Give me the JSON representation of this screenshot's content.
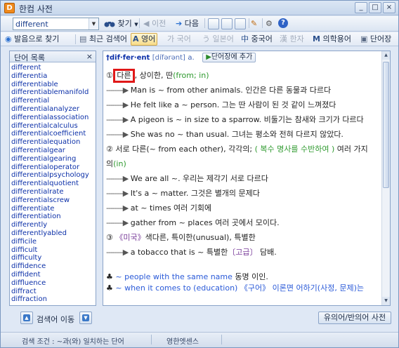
{
  "window": {
    "app_icon": "D",
    "title": "한컴 사전",
    "controls": [
      "_",
      "□",
      "×"
    ]
  },
  "toolbar": {
    "search_value": "different",
    "find_label": "찾기",
    "prev_label": "이전",
    "next_label": "다음"
  },
  "filters": {
    "pronounce_find": "발음으로 찾기",
    "recent": "최근 검색어",
    "english": "영어",
    "korean": "국어",
    "japanese": "일본어",
    "chinese": "중국어",
    "hanja": "한자",
    "medical": "의학용어",
    "wordbook": "단어장"
  },
  "left_panel": {
    "title": "단어 목록",
    "close": "×",
    "words": [
      "different",
      "differentia",
      "differentiable",
      "differentiablemanifold",
      "differential",
      "differentialanalyzer",
      "differentialassociation",
      "differentialcalculus",
      "differentialcoefficient",
      "differentialequation",
      "differentialgear",
      "differentialgearing",
      "differentialoperator",
      "differentialpsychology",
      "differentialquotient",
      "differentialrate",
      "differentialscrew",
      "differentiate",
      "differentiation",
      "differently",
      "differentlyabled",
      "difficile",
      "difficult",
      "difficulty",
      "diffidence",
      "diffident",
      "diffluence",
      "diffract",
      "diffraction"
    ]
  },
  "entry": {
    "headword": "†dif·fer·ent",
    "pronunciation": "[dífərənt]",
    "pos": "a.",
    "add_button": "단어장에 추가",
    "sense1_num": "①",
    "sense1_highlight": "다른",
    "sense1_rest": ", 상이한, 딴",
    "sense1_tag": "(from; in)",
    "dash": "--------▶",
    "ex1": "Man is ~ from other animals. 인간은 다른 동물과 다르다",
    "ex2": "He felt like a ~ person. 그는 딴 사람이 된 것 같이 느껴졌다",
    "ex3": "A pigeon is ~ in size to a sparrow. 비둘기는 참새와 크기가 다르다",
    "ex4": "She was no ~ than usual. 그녀는 평소와 전혀 다르지 않았다.",
    "sense2_num": "②",
    "sense2_text": "서로 다른(~ from each other), 각각의;",
    "sense2_note": "( 복수 명사를 수반하여 )",
    "sense2_tail": "여러 가지",
    "sense2_line2_a": "의",
    "sense2_line2_tag": "(in)",
    "ex5": "We are all ~. 우리는 제각기 서로 다르다",
    "ex6": "It's a ~ matter. 그것은 별개의 문제다",
    "ex7": "at ~ times 여러 기회에",
    "ex8": "gather from ~ places 여러 곳에서 모이다.",
    "sense3_num": "③",
    "sense3_label": "《미국》",
    "sense3_text": "색다른, 특이한(unusual), 특별한",
    "ex9_a": "a tobacco that is ~ 특별한",
    "ex9_tag": "〔고급〕",
    "ex9_b": "담배.",
    "idiom_mark": "♣",
    "idiom_en": "~ people with the same name",
    "idiom_ko": "동명 이인.",
    "idiom2_mark": "♣",
    "idiom2_text": "~ when it comes to (education)  《구어》 이론면 어하기(사정, 문제)는"
  },
  "bottom": {
    "nav_label": "검색어 이동",
    "synonym_button": "유의어/반의어 사전"
  },
  "status": {
    "condition": "검색 조건 : ~과(와) 일치하는 단어",
    "dictionary": "영한엣센스"
  }
}
